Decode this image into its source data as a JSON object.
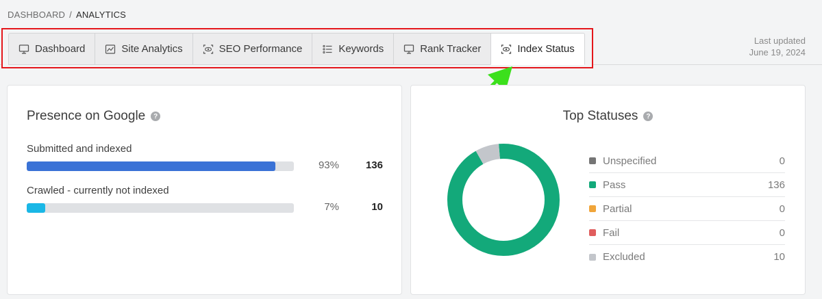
{
  "breadcrumb": {
    "root": "DASHBOARD",
    "separator": "/",
    "current": "ANALYTICS"
  },
  "tabs": [
    {
      "label": "Dashboard",
      "icon": "monitor-icon"
    },
    {
      "label": "Site Analytics",
      "icon": "line-chart-icon"
    },
    {
      "label": "SEO Performance",
      "icon": "eye-scan-icon"
    },
    {
      "label": "Keywords",
      "icon": "list-icon"
    },
    {
      "label": "Rank Tracker",
      "icon": "monitor-icon"
    },
    {
      "label": "Index Status",
      "icon": "eye-scan-icon",
      "active": true
    }
  ],
  "last_updated": {
    "label": "Last updated",
    "date": "June 19, 2024"
  },
  "presence": {
    "title": "Presence on Google",
    "metrics": [
      {
        "label": "Submitted and indexed",
        "percent": "93%",
        "fraction": 0.93,
        "count": "136",
        "color": "#3a72d6"
      },
      {
        "label": "Crawled - currently not indexed",
        "percent": "7%",
        "fraction": 0.07,
        "count": "10",
        "color": "#1ab7e6"
      }
    ]
  },
  "top_statuses": {
    "title": "Top Statuses",
    "items": [
      {
        "name": "Unspecified",
        "value": "0",
        "color": "#757575"
      },
      {
        "name": "Pass",
        "value": "136",
        "color": "#13a97a"
      },
      {
        "name": "Partial",
        "value": "0",
        "color": "#f0a53a"
      },
      {
        "name": "Fail",
        "value": "0",
        "color": "#e05d5d"
      },
      {
        "name": "Excluded",
        "value": "10",
        "color": "#c3c6cb"
      }
    ],
    "donut": [
      {
        "name": "Pass",
        "value": 136,
        "color": "#13a97a"
      },
      {
        "name": "Excluded",
        "value": 10,
        "color": "#c3c6cb"
      }
    ]
  },
  "colors": {
    "highlight_frame": "#e4161b",
    "annotation_arrow": "#3ce01c"
  }
}
